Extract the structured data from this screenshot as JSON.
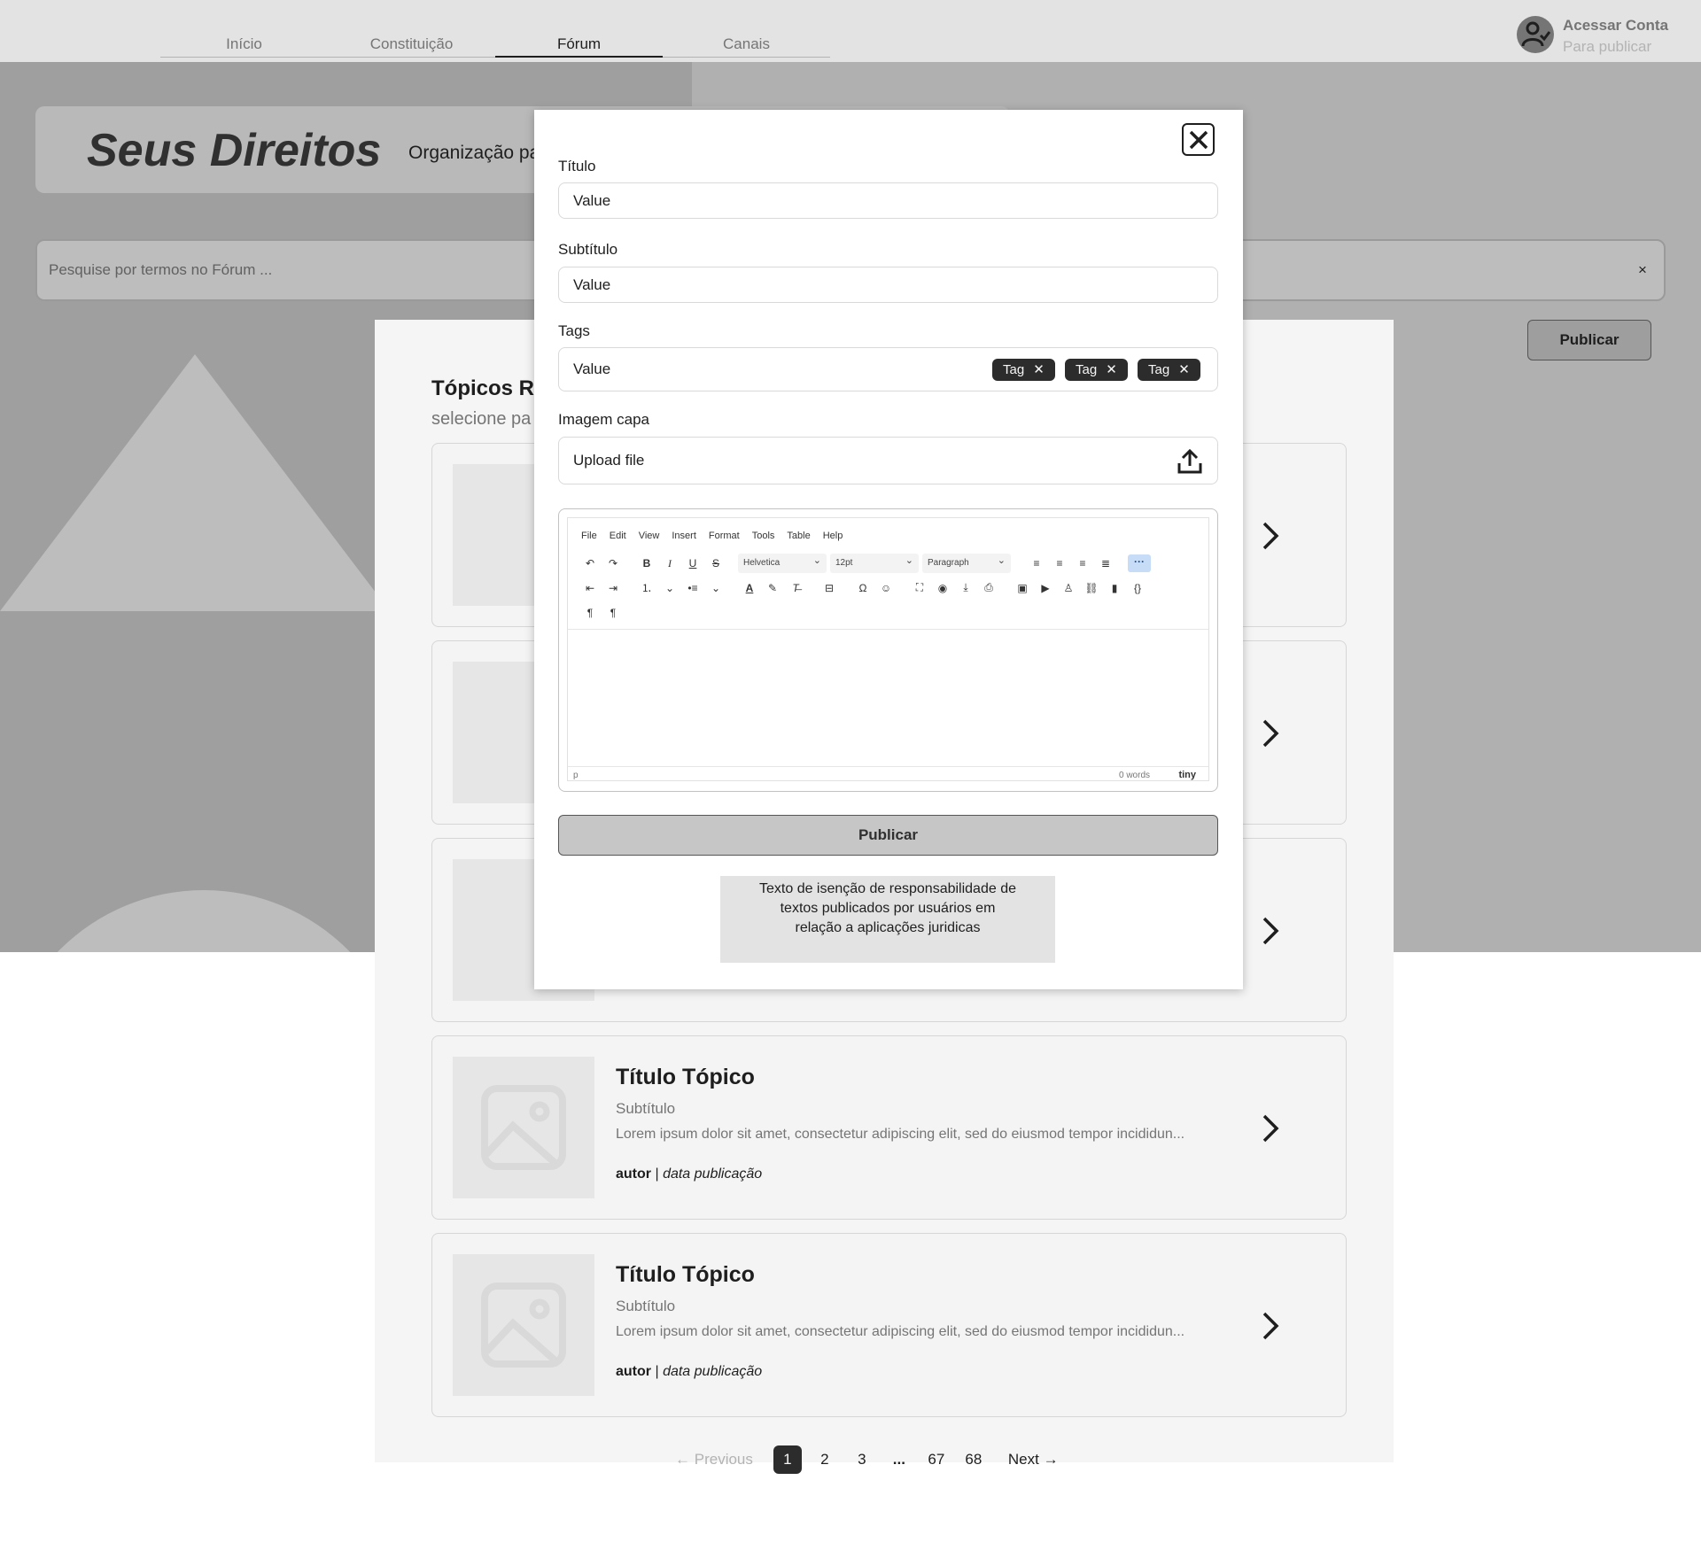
{
  "nav": {
    "tabs": [
      {
        "label": "Início"
      },
      {
        "label": "Constituição"
      },
      {
        "label": "Fórum"
      },
      {
        "label": "Canais"
      }
    ],
    "active_tab": "Fórum",
    "account": {
      "title": "Acessar Conta",
      "subtitle": "Para publicar"
    }
  },
  "hero": {
    "brand": "Seus Direitos",
    "tagline": "Organização pa",
    "search_placeholder": "Pesquise por termos no Fórum ...",
    "search_clear": "×",
    "publish_label": "Publicar"
  },
  "list": {
    "title": "Tópicos Re",
    "subtitle": "selecione pa",
    "topics": [
      {
        "title": "Título Tópico",
        "subtitle": "Subtítulo",
        "text": "Lorem ipsum dolor sit amet, consectetur adipiscing elit, sed do eiusmod tempor incididun...",
        "author": "autor",
        "sep": "|",
        "date": "data publicação"
      },
      {
        "title": "Título Tópico",
        "subtitle": "Subtítulo",
        "text": "Lorem ipsum dolor sit amet, consectetur adipiscing elit, sed do eiusmod tempor incididun...",
        "author": "autor",
        "sep": "|",
        "date": "data publicação"
      }
    ]
  },
  "pagination": {
    "previous": "Previous",
    "pages": [
      "1",
      "2",
      "3",
      "...",
      "67",
      "68"
    ],
    "current": "1",
    "next": "Next"
  },
  "modal": {
    "title_label": "Título",
    "title_value": "Value",
    "subtitle_label": "Subtítulo",
    "subtitle_value": "Value",
    "tags_label": "Tags",
    "tags_value": "Value",
    "tags": [
      "Tag",
      "Tag",
      "Tag"
    ],
    "image_label": "Imagem capa",
    "upload_label": "Upload file",
    "editor": {
      "menu": [
        "File",
        "Edit",
        "View",
        "Insert",
        "Format",
        "Tools",
        "Table",
        "Help"
      ],
      "font": "Helvetica",
      "size": "12pt",
      "block": "Paragraph",
      "status_path": "p",
      "word_count": "0 words",
      "brand": "tiny"
    },
    "publish_label": "Publicar",
    "disclaimer": "Texto de isenção de responsabilidade de textos publicados por usuários em relação a aplicações juridicas"
  }
}
